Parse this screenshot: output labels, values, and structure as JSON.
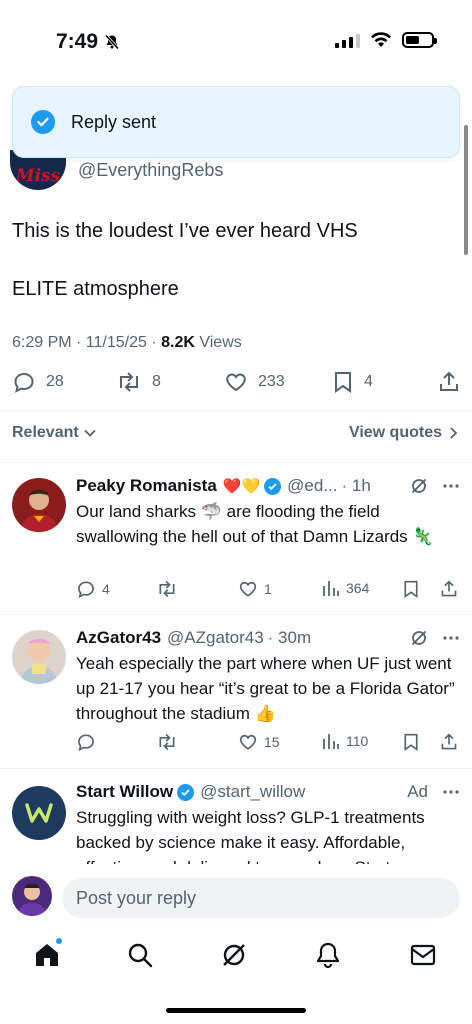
{
  "status": {
    "time": "7:49"
  },
  "toast": {
    "text": "Reply sent"
  },
  "post": {
    "logo_text": "Miss",
    "handle": "@EverythingRebs",
    "text_line1": "This is the loudest I’ve ever heard VHS",
    "text_line2": "ELITE atmosphere",
    "meta_time": "6:29 PM · 11/15/25 · ",
    "meta_views_count": "8.2K",
    "meta_views_label": " Views",
    "stats": {
      "replies": "28",
      "reposts": "8",
      "likes": "233",
      "bookmarks": "4"
    }
  },
  "sort": {
    "label": "Relevant",
    "view_quotes": "View quotes"
  },
  "replies": [
    {
      "name": "Peaky Romanista",
      "emojis": "❤️💛",
      "handle": "@ed...",
      "time": "· 1h",
      "text": "Our land sharks 🦈 are flooding the field swallowing the hell out of that Damn Lizards 🦎",
      "replies": "4",
      "reposts": "",
      "likes": "1",
      "views": "364"
    },
    {
      "name": "AzGator43",
      "handle": "@AZgator43",
      "time": "· 30m",
      "text": "Yeah especially the part where when UF just went up 21-17 you hear “it’s great to be a Florida Gator” throughout the stadium 👍",
      "replies": "",
      "reposts": "",
      "likes": "15",
      "views": "110"
    },
    {
      "name": "Start Willow",
      "handle": "@start_willow",
      "badge": "Ad",
      "text": "Struggling with weight loss? GLP-1 treatments backed by science make it easy. Affordable, effective, and delivered to your door. Start"
    }
  ],
  "compose": {
    "placeholder": "Post your reply"
  },
  "colors": {
    "accent": "#1d9bf0",
    "text": "#0f1419",
    "muted": "#536471",
    "toast_bg": "#e8f4fd"
  }
}
